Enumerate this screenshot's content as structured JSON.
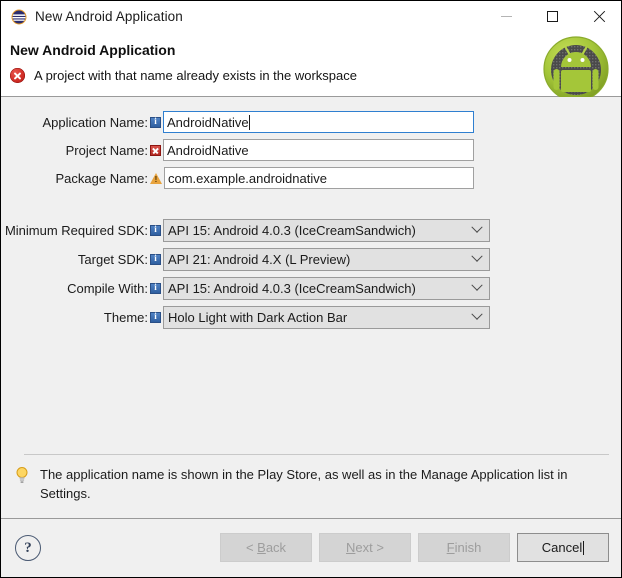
{
  "window": {
    "title": "New Android Application",
    "icon": "eclipse-icon",
    "controls": {
      "minimize": "minimize-icon",
      "maximize": "maximize-icon",
      "close": "close-icon"
    }
  },
  "header": {
    "title": "New Android Application",
    "message": "A project with that name already exists in the workspace",
    "message_icon": "error-icon",
    "logo": "android-robot-logo",
    "colors": {
      "error_red": "#cf2b24",
      "android_green": "#a4c639",
      "header_bg": "#ffffff"
    }
  },
  "form": {
    "text_fields": [
      {
        "label": "Application Name:",
        "badge": "info-icon",
        "value": "AndroidNative",
        "focused": true
      },
      {
        "label": "Project Name:",
        "badge": "error-icon",
        "value": "AndroidNative",
        "focused": false
      },
      {
        "label": "Package Name:",
        "badge": "warning-icon",
        "value": "com.example.androidnative",
        "focused": false
      }
    ],
    "dropdowns": [
      {
        "label": "Minimum Required SDK:",
        "badge": "info-icon",
        "value": "API 15: Android 4.0.3 (IceCreamSandwich)"
      },
      {
        "label": "Target SDK:",
        "badge": "info-icon",
        "value": "API 21: Android 4.X (L Preview)"
      },
      {
        "label": "Compile With:",
        "badge": "info-icon",
        "value": "API 15: Android 4.0.3 (IceCreamSandwich)"
      },
      {
        "label": "Theme:",
        "badge": "info-icon",
        "value": "Holo Light with Dark Action Bar"
      }
    ]
  },
  "note": {
    "icon": "lightbulb-icon",
    "text": "The application name is shown in the Play Store, as well as in the Manage Application list in Settings."
  },
  "footer": {
    "help_icon": "question-mark-icon",
    "buttons": [
      {
        "label_prefix": "< ",
        "mnemonic": "B",
        "label_suffix": "ack",
        "enabled": false
      },
      {
        "label_prefix": "",
        "mnemonic": "N",
        "label_suffix": "ext >",
        "enabled": false
      },
      {
        "label_prefix": "",
        "mnemonic": "F",
        "label_suffix": "inish",
        "enabled": false
      },
      {
        "label_prefix": "",
        "mnemonic": "",
        "label_suffix": "Cancel",
        "enabled": true
      }
    ]
  }
}
